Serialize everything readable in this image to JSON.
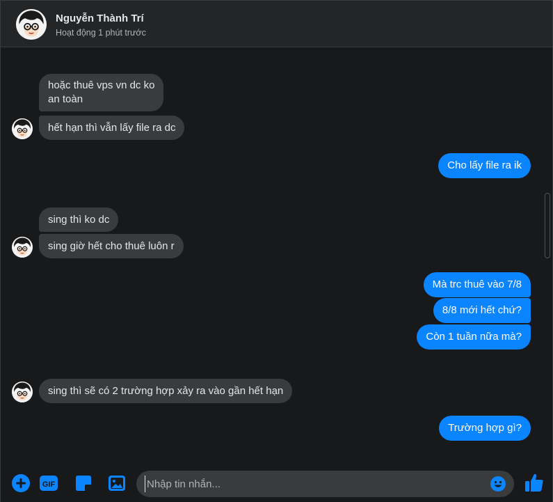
{
  "header": {
    "name": "Nguyễn Thành Trí",
    "status": "Hoạt động 1 phút trước"
  },
  "messages": [
    {
      "side": "in",
      "lines": [
        "hoặc thuê vps vn dc ko",
        "an toàn"
      ]
    },
    {
      "side": "in",
      "lines": [
        "hết hạn thì vẫn lấy file ra dc"
      ]
    },
    {
      "side": "out",
      "lines": [
        "Cho lấy file ra ik"
      ]
    },
    {
      "side": "in",
      "lines": [
        "sing thì ko dc"
      ]
    },
    {
      "side": "in",
      "lines": [
        "sing giờ hết cho thuê luôn r"
      ]
    },
    {
      "side": "out",
      "lines": [
        "Mà trc thuê vào 7/8"
      ]
    },
    {
      "side": "out",
      "lines": [
        "8/8 mới hết chứ?"
      ]
    },
    {
      "side": "out",
      "lines": [
        "Còn 1 tuần nữa mà?"
      ]
    },
    {
      "side": "in",
      "lines": [
        "sing thì sẽ có 2 trường hợp xảy ra vào gần hết hạn"
      ]
    },
    {
      "side": "out",
      "lines": [
        "Trường hợp gì?"
      ]
    }
  ],
  "composer": {
    "placeholder": "Nhập tin nhắn...",
    "gif_label": "GIF",
    "icons": [
      "plus-circle-icon",
      "gif-icon",
      "sticker-icon",
      "image-icon",
      "emoji-icon",
      "thumbs-up-icon"
    ]
  },
  "colors": {
    "background": "#18191a",
    "header": "#242526",
    "incoming_bubble": "#3a3b3c",
    "outgoing_bubble": "#0a84ff",
    "accent": "#0a84ff"
  }
}
